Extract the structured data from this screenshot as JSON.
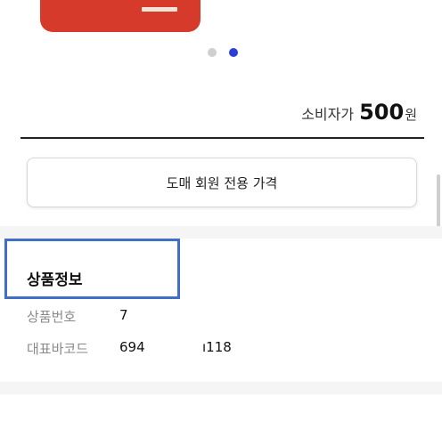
{
  "product": {
    "carousel": {
      "total": 2,
      "active": 1
    },
    "price": {
      "label": "소비자가",
      "amount": "500",
      "unit": "원"
    },
    "wholesale_button_label": "도매 회원 전용 가격"
  },
  "product_info": {
    "title": "상품정보",
    "rows": [
      {
        "label": "상품번호",
        "value": "7"
      },
      {
        "label": "대표바코드",
        "value": "694",
        "value_tail": "ı118"
      }
    ]
  },
  "colors": {
    "accent": "#2b3fd6",
    "image_red": "#d63a2a",
    "highlight_box": "#3f6fc7"
  }
}
